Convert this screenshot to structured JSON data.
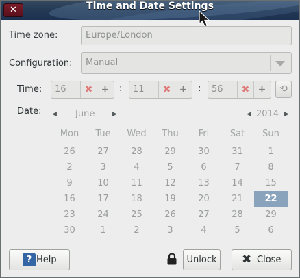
{
  "window": {
    "title": "Time and Date Settings"
  },
  "timezone": {
    "label": "Time zone:",
    "value": "Europe/London"
  },
  "configuration": {
    "label": "Configuration:",
    "value": "Manual"
  },
  "time": {
    "label": "Time:",
    "hours": "16",
    "minutes": "11",
    "seconds": "56",
    "sep1": ":",
    "sep2": ":"
  },
  "date": {
    "label": "Date:",
    "month": "June",
    "year": "2014"
  },
  "calendar": {
    "weekdays": [
      "Mon",
      "Tue",
      "Wed",
      "Thu",
      "Fri",
      "Sat",
      "Sun"
    ],
    "weeks": [
      [
        "26",
        "27",
        "28",
        "29",
        "30",
        "31",
        "1"
      ],
      [
        "2",
        "3",
        "4",
        "5",
        "6",
        "7",
        "8"
      ],
      [
        "9",
        "10",
        "11",
        "12",
        "13",
        "14",
        "15"
      ],
      [
        "16",
        "17",
        "18",
        "19",
        "20",
        "21",
        "22"
      ],
      [
        "23",
        "24",
        "25",
        "26",
        "27",
        "28",
        "29"
      ],
      [
        "30",
        "1",
        "2",
        "3",
        "4",
        "5",
        "6"
      ]
    ],
    "selected_day": "22"
  },
  "buttons": {
    "help": "Help",
    "unlock": "Unlock",
    "close": "Close"
  },
  "icons": {
    "window_close": "close-icon",
    "clear": "clear-icon",
    "add": "plus-icon",
    "refresh": "refresh-icon",
    "help": "help-icon",
    "lock": "lock-icon"
  },
  "colors": {
    "titlebar": "#243a55",
    "selected_day_bg": "#8aa3bc",
    "help_icon": "#3465a4"
  }
}
